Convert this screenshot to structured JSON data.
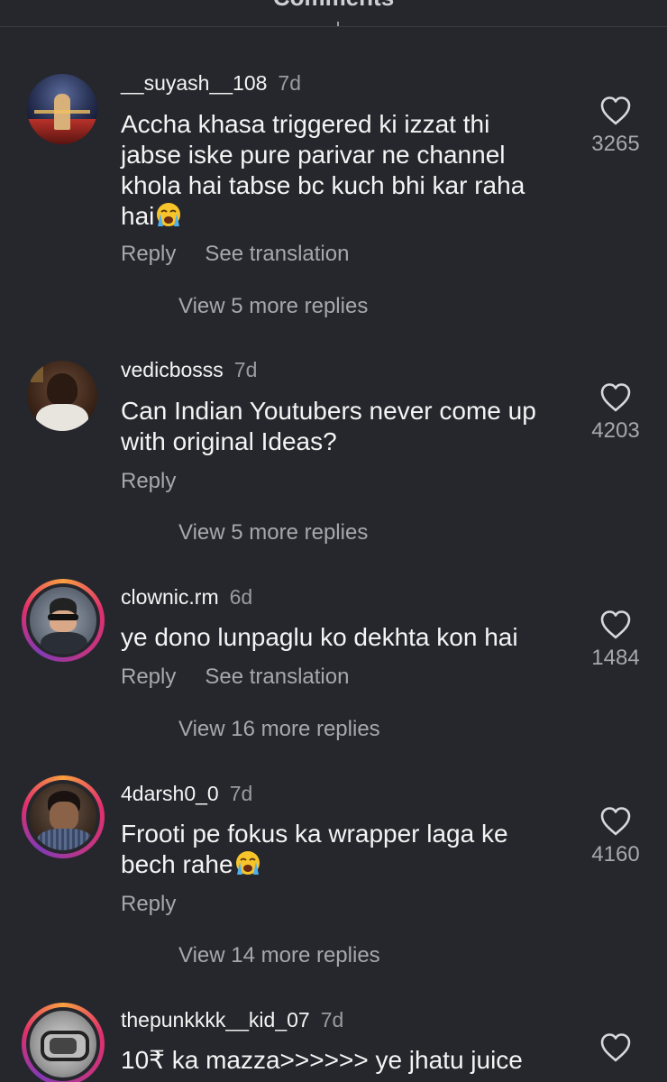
{
  "header": {
    "title": "Comments"
  },
  "comments": [
    {
      "username": "__suyash__108",
      "time": "7d",
      "text": "Accha khasa triggered ki izzat thi jabse iske pure parivar ne channel khola hai tabse bc kuch bhi kar raha hai",
      "emoji": "loudly-crying-face",
      "reply_label": "Reply",
      "translation_label": "See translation",
      "likes": "3265",
      "view_replies": "View 5 more replies"
    },
    {
      "username": "vedicbosss",
      "time": "7d",
      "text": "Can Indian Youtubers never come up with original Ideas?",
      "reply_label": "Reply",
      "likes": "4203",
      "view_replies": "View 5 more replies"
    },
    {
      "username": "clownic.rm",
      "time": "6d",
      "text": "ye dono lunpaglu ko dekhta kon hai",
      "reply_label": "Reply",
      "translation_label": "See translation",
      "likes": "1484",
      "view_replies": "View 16 more replies"
    },
    {
      "username": "4darsh0_0",
      "time": "7d",
      "text": "Frooti pe fokus ka wrapper laga ke bech rahe",
      "emoji": "loudly-crying-face",
      "reply_label": "Reply",
      "likes": "4160",
      "view_replies": "View 14 more replies"
    },
    {
      "username": "thepunkkkk__kid_07",
      "time": "7d",
      "text": "10₹ ka mazza>>>>>> ye jhatu juice"
    }
  ],
  "colors": {
    "background": "#25272d",
    "text": "#f4f4f4",
    "muted": "#a6a8ad",
    "story_ring": "#e1306c"
  }
}
